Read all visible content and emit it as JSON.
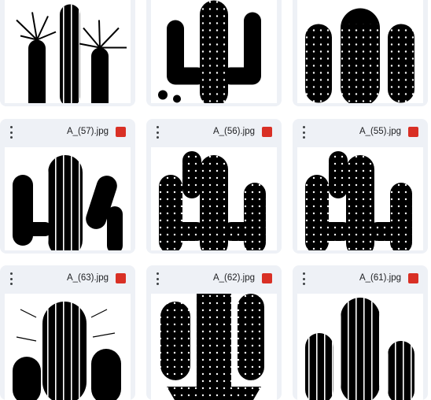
{
  "files": [
    {
      "name": "A_(57).jpg",
      "icon": "image-file-icon"
    },
    {
      "name": "A_(56).jpg",
      "icon": "image-file-icon"
    },
    {
      "name": "A_(55).jpg",
      "icon": "image-file-icon"
    },
    {
      "name": "A_(63).jpg",
      "icon": "image-file-icon"
    },
    {
      "name": "A_(62).jpg",
      "icon": "image-file-icon"
    },
    {
      "name": "A_(61).jpg",
      "icon": "image-file-icon"
    }
  ],
  "colors": {
    "card_bg": "#eef1f6",
    "image_icon": "#d93025",
    "cactus": "#000000"
  }
}
